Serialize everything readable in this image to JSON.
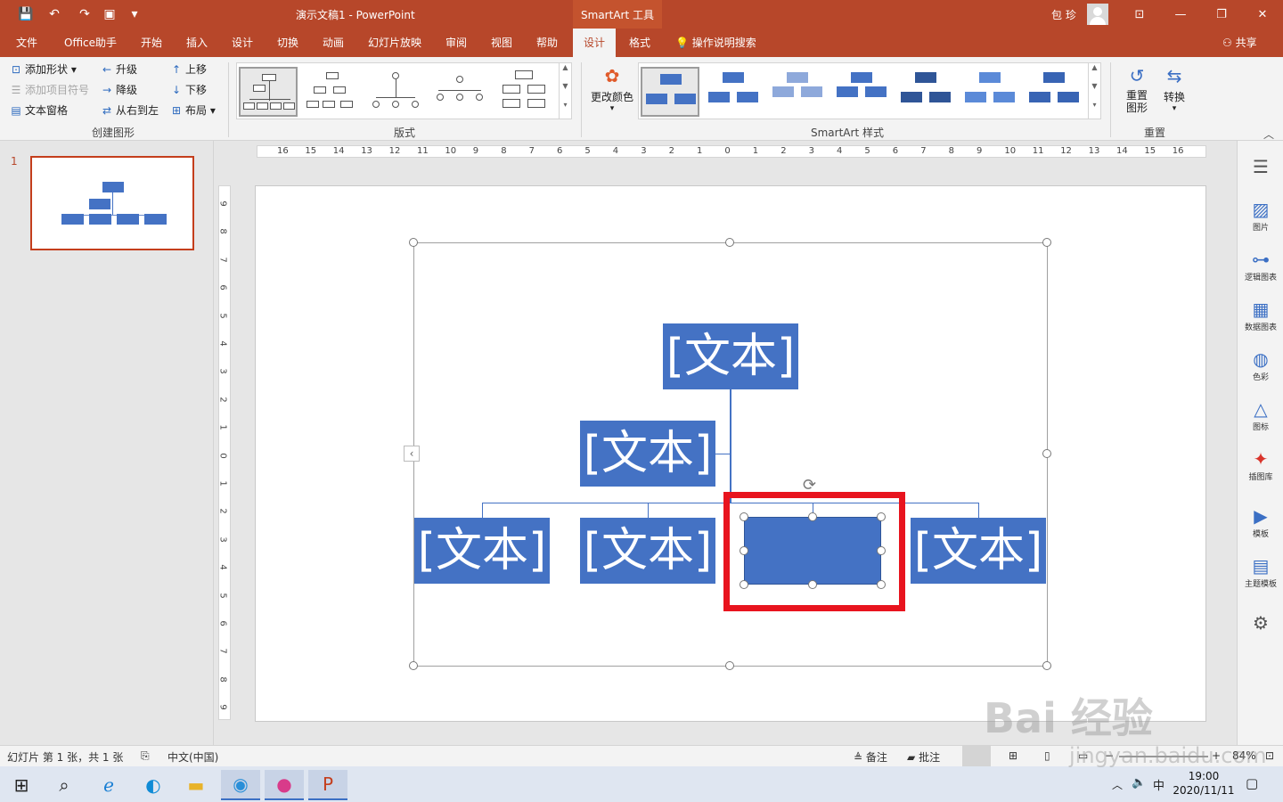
{
  "titlebar": {
    "doc_title": "演示文稿1  -  PowerPoint",
    "contextual_title": "SmartArt 工具",
    "user_name": "包 珍"
  },
  "tabs": [
    "文件",
    "Office助手",
    "开始",
    "插入",
    "设计",
    "切换",
    "动画",
    "幻灯片放映",
    "审阅",
    "视图",
    "帮助",
    "设计",
    "格式"
  ],
  "tell_me": "操作说明搜索",
  "share": "共享",
  "ribbon": {
    "create_graphic": {
      "add_shape": "添加形状",
      "add_bullet": "添加项目符号",
      "text_pane": "文本窗格",
      "promote": "升级",
      "demote": "降级",
      "right_to_left": "从右到左",
      "move_up": "上移",
      "move_down": "下移",
      "layout": "布局",
      "label": "创建图形"
    },
    "layouts_label": "版式",
    "change_colors": "更改颜色",
    "styles_label": "SmartArt 样式",
    "reset_graphic": "重置\n图形",
    "convert": "转换",
    "reset_label": "重置"
  },
  "ruler_numbers": [
    "16",
    "15",
    "14",
    "13",
    "12",
    "11",
    "10",
    "9",
    "8",
    "7",
    "6",
    "5",
    "4",
    "3",
    "2",
    "1",
    "0",
    "1",
    "2",
    "3",
    "4",
    "5",
    "6",
    "7",
    "8",
    "9",
    "10",
    "11",
    "12",
    "13",
    "14",
    "15",
    "16"
  ],
  "vruler_numbers": [
    "9",
    "8",
    "7",
    "6",
    "5",
    "4",
    "3",
    "2",
    "1",
    "0",
    "1",
    "2",
    "3",
    "4",
    "5",
    "6",
    "7",
    "8",
    "9"
  ],
  "thumbnail": {
    "slide_number": "1"
  },
  "nodes": {
    "top": "[文本]",
    "assistant": "[文本]",
    "child1": "[文本]",
    "child2": "[文本]",
    "child3": "",
    "child4": "[文本]"
  },
  "right_pane": [
    "图片",
    "逻辑图表",
    "数据图表",
    "色彩",
    "图标",
    "插图库",
    "模板",
    "主题模板"
  ],
  "status": {
    "slide_info": "幻灯片 第 1 张，共 1 张",
    "language": "中文(中国)",
    "notes": "备注",
    "comments": "批注",
    "zoom": "84%"
  },
  "taskbar": {
    "time": "19:00",
    "date": "2020/11/11",
    "ime": "中"
  },
  "watermark": {
    "brand": "Bai 经验",
    "url": "jingyan.baidu.com"
  }
}
